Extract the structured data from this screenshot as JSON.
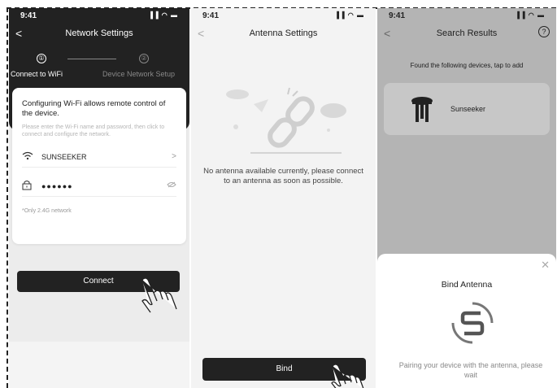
{
  "status_time": "9:41",
  "status_signal": "▐▐ ◠ ▬",
  "screen1": {
    "back": "<",
    "title": "Network Settings",
    "steps": [
      {
        "num": "①",
        "label": "Connect to WiFi"
      },
      {
        "num": "②",
        "label": "Device Network Setup"
      }
    ],
    "intro": "Configuring Wi-Fi allows remote control of the device.",
    "hint": "Please enter the Wi-Fi name and password, then click to connect and configure the network.",
    "wifi_name": "SUNSEEKER",
    "password_mask": "●●●●●●",
    "note": "*Only 2.4G network",
    "connect_label": "Connect"
  },
  "screen2": {
    "back": "<",
    "title": "Antenna Settings",
    "empty_message": "No antenna available currently, please connect to an antenna as soon as possible.",
    "bind_label": "Bind"
  },
  "screen3": {
    "back": "<",
    "title": "Search Results",
    "help": "?",
    "found_text": "Found the following devices, tap to add",
    "device_name": "Sunseeker",
    "sheet": {
      "close": "✕",
      "title": "Bind Antenna",
      "pairing": "Pairing your device with the antenna, please wait"
    }
  }
}
